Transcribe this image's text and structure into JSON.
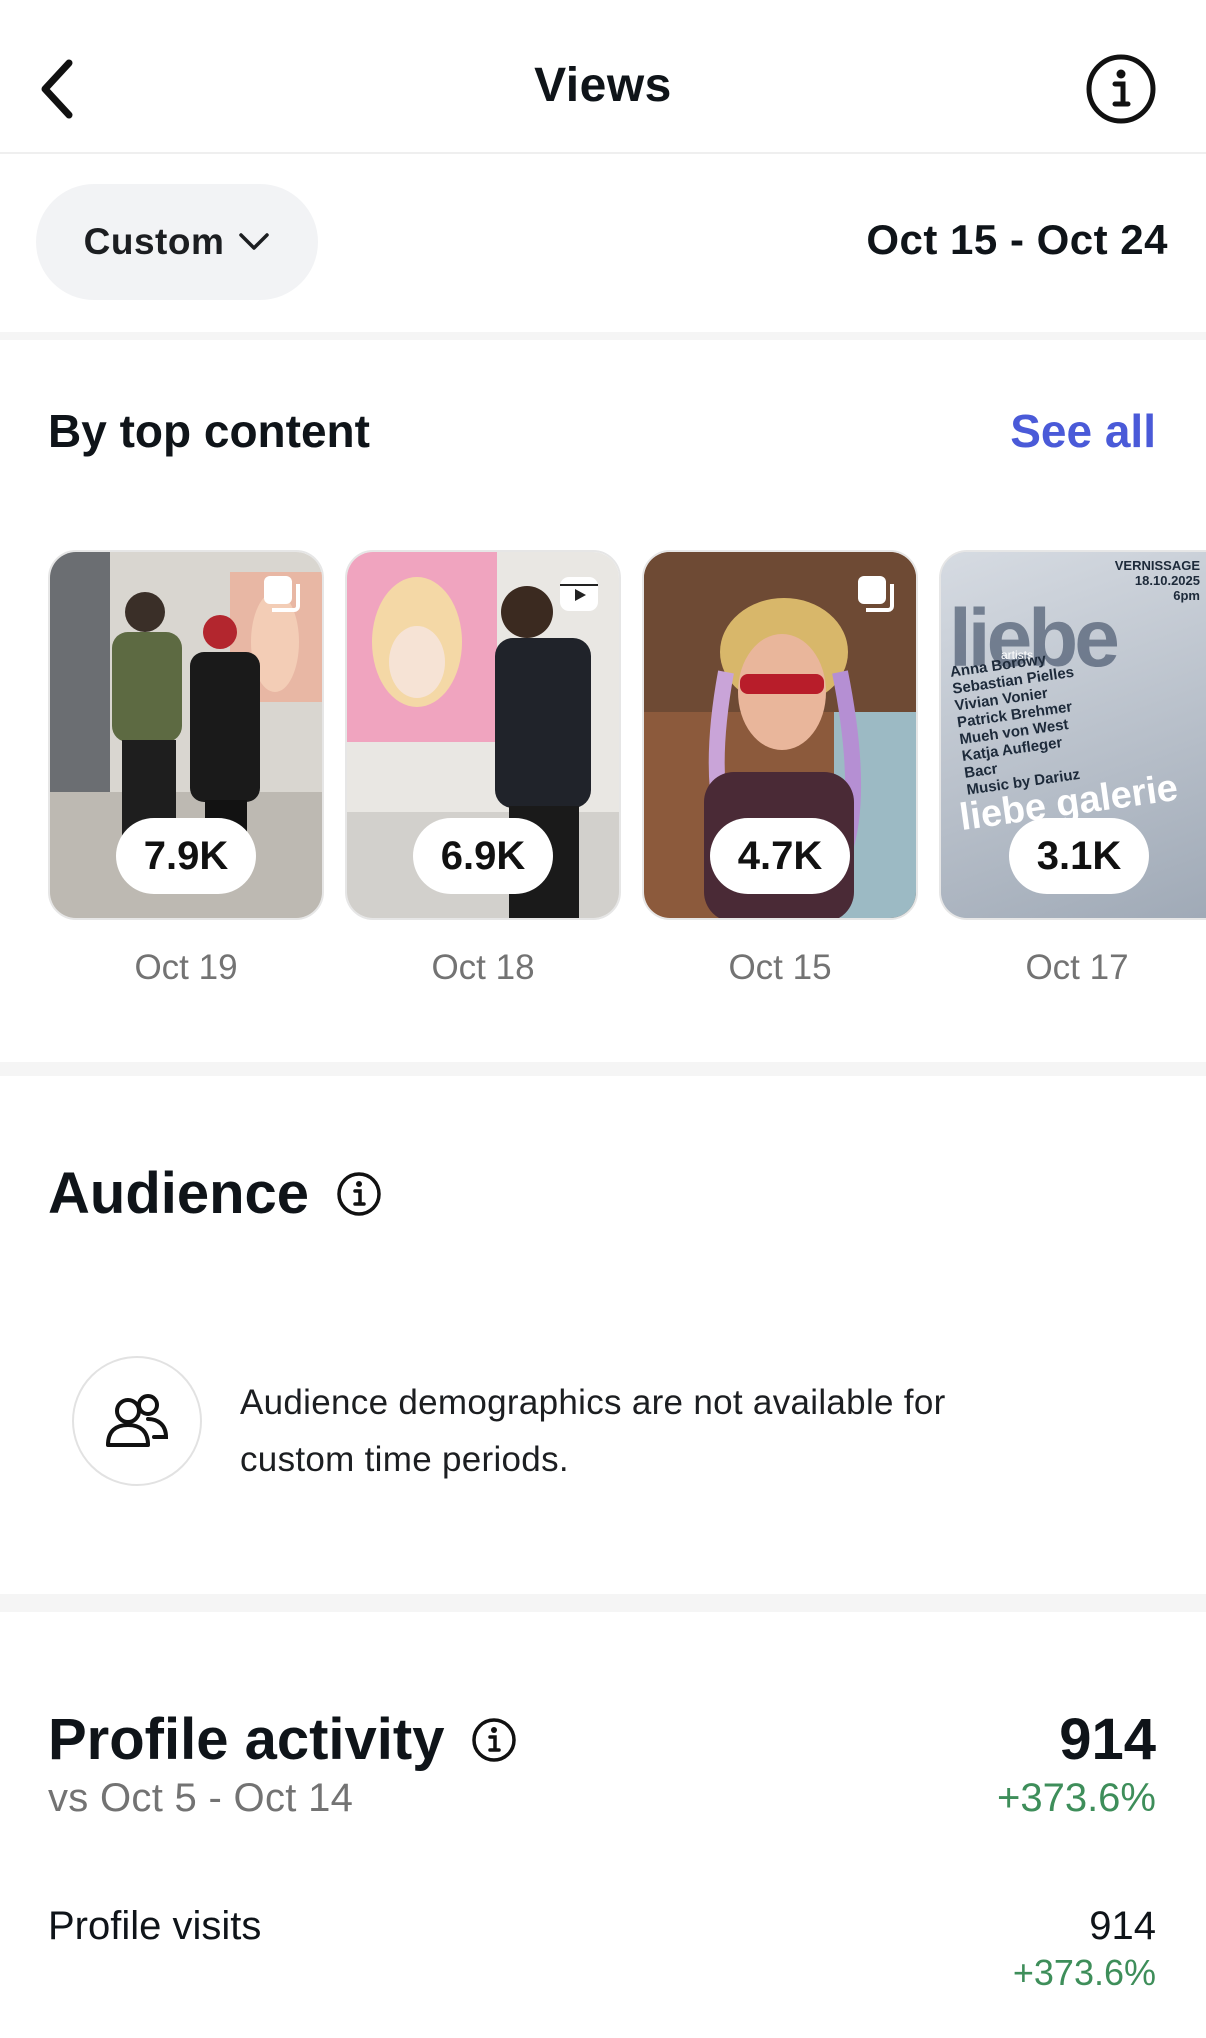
{
  "header": {
    "title": "Views",
    "back_icon": "chevron-left-icon",
    "info_icon": "info-icon"
  },
  "filter": {
    "range_select": "Custom",
    "date_range": "Oct 15 - Oct 24"
  },
  "top_content": {
    "title": "By top content",
    "see_all": "See all",
    "items": [
      {
        "views": "7.9K",
        "date": "Oct 19",
        "type_icon": "carousel-icon"
      },
      {
        "views": "6.9K",
        "date": "Oct 18",
        "type_icon": "reel-icon"
      },
      {
        "views": "4.7K",
        "date": "Oct 15",
        "type_icon": "carousel-icon"
      },
      {
        "views": "3.1K",
        "date": "Oct 17",
        "type_icon": "carousel-icon"
      }
    ],
    "poster_text": {
      "heading": "VERNISSAGE",
      "date": "18.10.2025",
      "time": "6pm",
      "artists_label": "artists",
      "artists": [
        "Anna Borowy",
        "Sebastian Pielles",
        "Vivian Vonier",
        "Patrick Brehmer",
        "Mueh von West",
        "Katja Aufleger",
        "Bacr"
      ],
      "music": "Music by Dariuz",
      "brand": "liebe galerie"
    }
  },
  "audience": {
    "title": "Audience",
    "message": "Audience demographics are not available for custom time periods.",
    "icon": "people-icon"
  },
  "profile_activity": {
    "title": "Profile activity",
    "compare": "vs Oct 5 - Oct 14",
    "total": "914",
    "total_change": "+373.6%",
    "rows": [
      {
        "label": "Profile visits",
        "value": "914",
        "change": "+373.6%"
      }
    ]
  },
  "colors": {
    "accent": "#4a5ad8",
    "positive": "#3e8e5a",
    "muted": "#737373"
  }
}
